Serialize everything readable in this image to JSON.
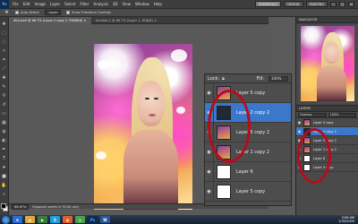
{
  "app": {
    "logo": "Ps",
    "menu": [
      "File",
      "Edit",
      "Image",
      "Layer",
      "Select",
      "Filter",
      "Analysis",
      "3D",
      "View",
      "Window",
      "Help"
    ],
    "workspace": "ESSENTIALS",
    "workspace_alts": [
      "DESIGN",
      "PAINTING"
    ],
    "window_buttons": [
      "–",
      "□",
      "×"
    ]
  },
  "options_bar": {
    "auto_select": "Auto-Select:",
    "select_value": "Layer",
    "show_transform": "Show Transform Controls"
  },
  "tabs": [
    {
      "label": "AVLuvell @ 66.7% (Layer 2 copy 2, RGB/8#) ×",
      "active": true
    },
    {
      "label": "Untitled-1 @ 66.7% (Layer 1, RGB/8) ×",
      "active": false
    }
  ],
  "status": {
    "zoom": "66.67%",
    "info": "Exposure works in 32-bit only"
  },
  "layers_popup": {
    "lock_label": "Lock:",
    "fill_label": "Fill:",
    "fill_value": "100%",
    "rows": [
      {
        "name": "Layer 5 copy",
        "thumb": "photo",
        "selected": false
      },
      {
        "name": "Layer 2 copy 2",
        "thumb": "dark",
        "selected": true
      },
      {
        "name": "Layer 5 copy 2",
        "thumb": "photo",
        "selected": false
      },
      {
        "name": "Layer 1 copy 2",
        "thumb": "photo",
        "selected": false
      },
      {
        "name": "Layer 6",
        "thumb": "blank",
        "selected": false
      },
      {
        "name": "Layer 5 copy",
        "thumb": "blank",
        "selected": false
      }
    ]
  },
  "nav_panel": {
    "tab": "NAVIGATOR"
  },
  "layers_panel": {
    "tab": "LAYERS",
    "blend": "Overlay",
    "opacity": "100%",
    "rows": [
      {
        "name": "Layer 5 copy",
        "selected": false
      },
      {
        "name": "Layer 2 copy 2",
        "selected": true
      },
      {
        "name": "Layer 5 copy 2",
        "selected": false
      },
      {
        "name": "Layer 1 copy 2",
        "selected": false
      },
      {
        "name": "Layer 6",
        "selected": false
      },
      {
        "name": "Layer 5 copy",
        "selected": false
      }
    ]
  },
  "taskbar": {
    "icons": [
      "ie-icon",
      "folder-icon",
      "media-icon",
      "skype-icon",
      "firefox-icon",
      "chrome-icon",
      "photoshop-icon",
      "word-icon"
    ],
    "time": "3:06 AM",
    "date": "1/30/2009"
  },
  "colors": {
    "selection": "#3b78c9",
    "annotation_ring": "#b50d1c",
    "panel_bg": "#4a4a4a"
  }
}
